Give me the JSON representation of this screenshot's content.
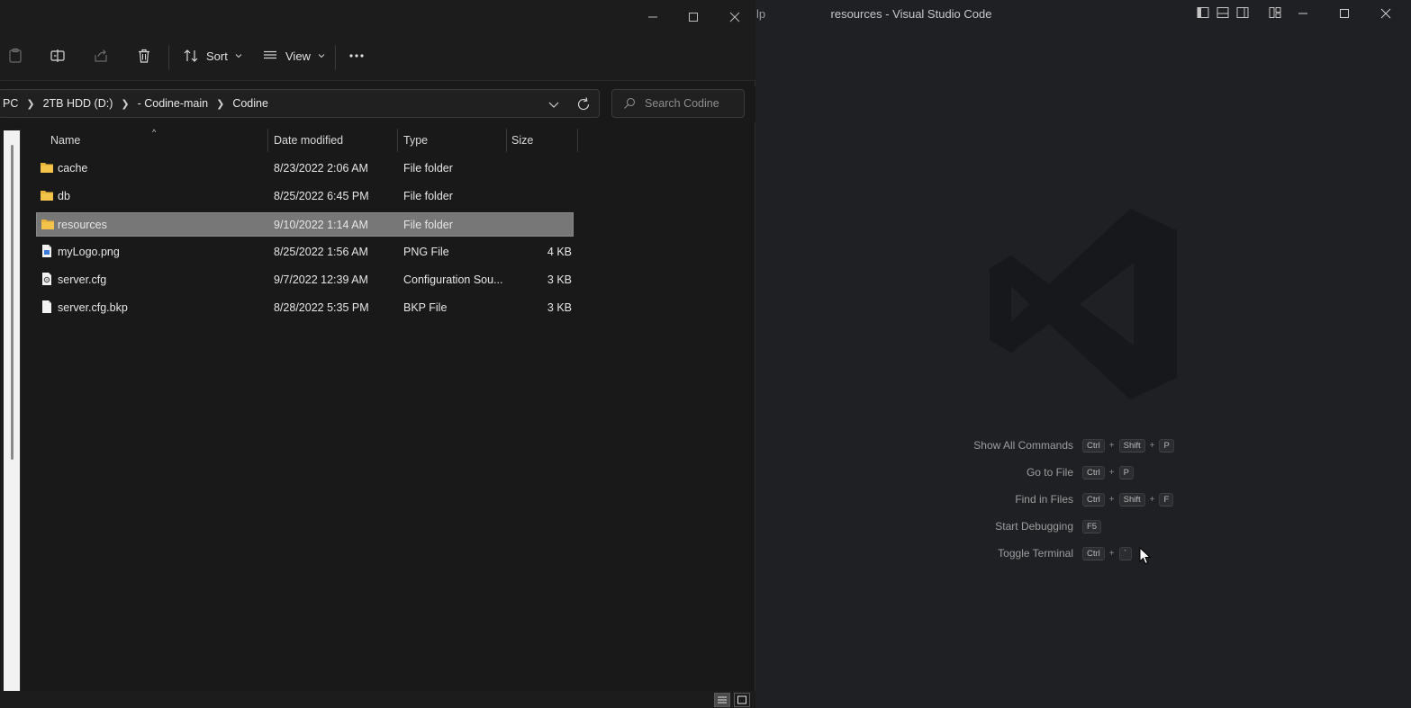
{
  "vscode": {
    "menu_fragment": "lp",
    "title": "resources - Visual Studio Code",
    "shortcuts": [
      {
        "label": "Show All Commands",
        "keys": [
          "Ctrl",
          "Shift",
          "P"
        ]
      },
      {
        "label": "Go to File",
        "keys": [
          "Ctrl",
          "P"
        ]
      },
      {
        "label": "Find in Files",
        "keys": [
          "Ctrl",
          "Shift",
          "F"
        ]
      },
      {
        "label": "Start Debugging",
        "keys": [
          "F5"
        ]
      },
      {
        "label": "Toggle Terminal",
        "keys": [
          "Ctrl",
          "`"
        ]
      }
    ]
  },
  "explorer": {
    "toolbar": {
      "sort_label": "Sort",
      "view_label": "View"
    },
    "breadcrumb": [
      "PC",
      "2TB HDD (D:)",
      "- Codine-main",
      "Codine"
    ],
    "search": {
      "placeholder": "Search Codine"
    },
    "columns": {
      "name": "Name",
      "date": "Date modified",
      "type": "Type",
      "size": "Size"
    },
    "files": [
      {
        "name": "cache",
        "date": "8/23/2022 2:06 AM",
        "type": "File folder",
        "size": "",
        "icon": "folder-icon",
        "selected": false
      },
      {
        "name": "db",
        "date": "8/25/2022 6:45 PM",
        "type": "File folder",
        "size": "",
        "icon": "folder-icon",
        "selected": false
      },
      {
        "name": "resources",
        "date": "9/10/2022 1:14 AM",
        "type": "File folder",
        "size": "",
        "icon": "folder-icon",
        "selected": true
      },
      {
        "name": "myLogo.png",
        "date": "8/25/2022 1:56 AM",
        "type": "PNG File",
        "size": "4 KB",
        "icon": "image-file-icon",
        "selected": false
      },
      {
        "name": "server.cfg",
        "date": "9/7/2022 12:39 AM",
        "type": "Configuration Sou...",
        "size": "3 KB",
        "icon": "config-file-icon",
        "selected": false
      },
      {
        "name": "server.cfg.bkp",
        "date": "8/28/2022 5:35 PM",
        "type": "BKP File",
        "size": "3 KB",
        "icon": "file-icon",
        "selected": false
      }
    ]
  },
  "colors": {
    "vscode_bg": "#1f2024",
    "explorer_bg": "#191919",
    "folder": "#f4c44a",
    "selection": "#777777"
  }
}
